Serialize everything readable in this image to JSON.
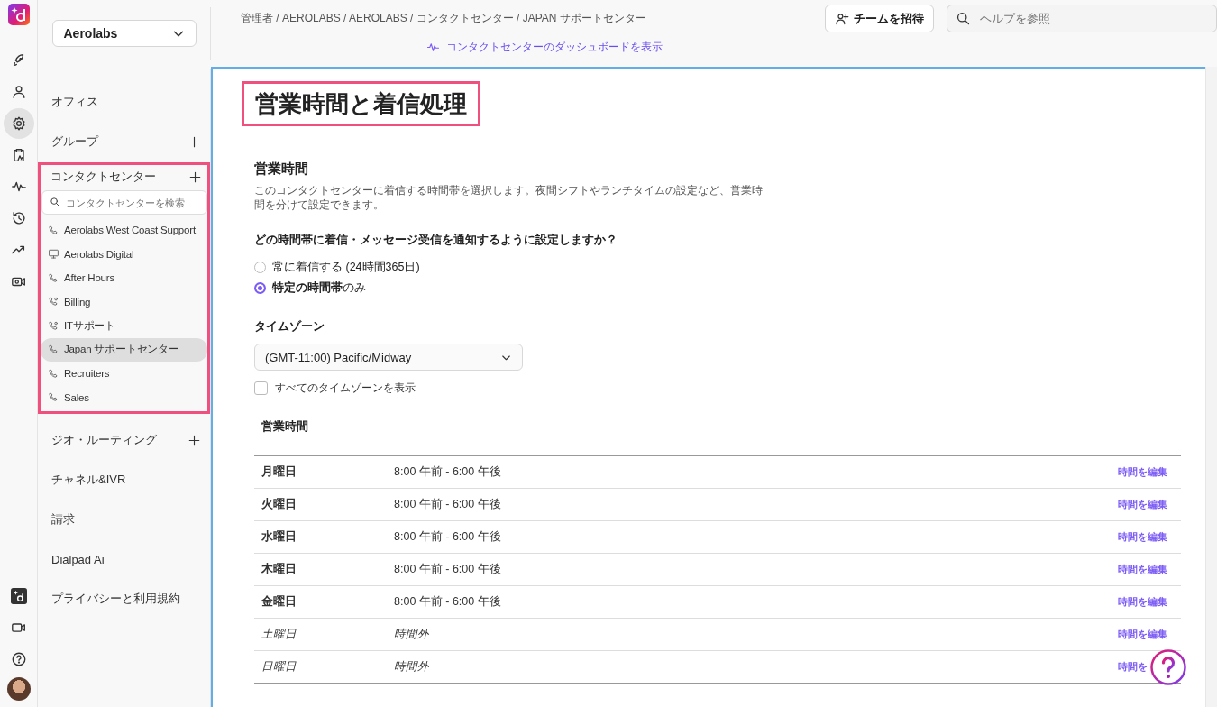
{
  "rail": {
    "top": [
      {
        "selected": false
      },
      {
        "selected": false
      },
      {
        "selected": true
      },
      {
        "selected": false
      },
      {
        "selected": false
      },
      {
        "selected": false
      },
      {
        "selected": false
      },
      {
        "selected": false
      }
    ]
  },
  "org_select": {
    "value": "Aerolabs"
  },
  "breadcrumb": "管理者 / AEROLABS / AEROLABS / コンタクトセンター / JAPAN サポートセンター",
  "dashboard_link": "コンタクトセンターのダッシュボードを表示",
  "invite_button": "チームを招待",
  "help_search": {
    "placeholder": "ヘルプを参照"
  },
  "sidebar": {
    "sections": [
      {
        "label": "オフィス",
        "addable": false
      },
      {
        "label": "グループ",
        "addable": true
      },
      {
        "label": "コンタクトセンター",
        "addable": true,
        "highlighted": true,
        "search": {
          "placeholder": "コンタクトセンターを検索"
        },
        "items": [
          {
            "label": "Aerolabs West Coast Support",
            "kind": "phone",
            "selected": false
          },
          {
            "label": "Aerolabs Digital",
            "kind": "monitor",
            "selected": false
          },
          {
            "label": "After Hours",
            "kind": "phone",
            "selected": false
          },
          {
            "label": "Billing",
            "kind": "phone-gear",
            "selected": false
          },
          {
            "label": "ITサポート",
            "kind": "phone-gear",
            "selected": false
          },
          {
            "label": "Japan サポートセンター",
            "kind": "phone",
            "selected": true
          },
          {
            "label": "Recruiters",
            "kind": "phone",
            "selected": false
          },
          {
            "label": "Sales",
            "kind": "phone",
            "selected": false
          }
        ]
      },
      {
        "label": "ジオ・ルーティング",
        "addable": true
      },
      {
        "label": "チャネル&IVR",
        "addable": false
      },
      {
        "label": "請求",
        "addable": false
      },
      {
        "label": "Dialpad Ai",
        "addable": false
      },
      {
        "label": "プライバシーと利用規約",
        "addable": false
      }
    ]
  },
  "page": {
    "title": "営業時間と着信処理",
    "title_highlighted": true,
    "section_title": "営業時間",
    "description": "このコンタクトセンターに着信する時間帯を選択します。夜間シフトやランチタイムの設定など、営業時間を分けて設定できます。",
    "question": "どの時間帯に着信・メッセージ受信を通知するように設定しますか？",
    "options": [
      {
        "label": "常に着信する (24時間365日)",
        "selected": false
      },
      {
        "label": "**特定の時間帯**のみ",
        "selected": true
      }
    ],
    "timezone_label": "タイムゾーン",
    "timezone_select": {
      "value": "(GMT-11:00) Pacific/Midway"
    },
    "show_all_timezones": {
      "label": "すべてのタイムゾーンを表示",
      "checked": false
    },
    "hours_heading": "営業時間",
    "hours": [
      {
        "day": "月曜日",
        "time": "8:00 午前 - 6:00 午後",
        "edit": "時間を編集",
        "off": false
      },
      {
        "day": "火曜日",
        "time": "8:00 午前 - 6:00 午後",
        "edit": "時間を編集",
        "off": false
      },
      {
        "day": "水曜日",
        "time": "8:00 午前 - 6:00 午後",
        "edit": "時間を編集",
        "off": false
      },
      {
        "day": "木曜日",
        "time": "8:00 午前 - 6:00 午後",
        "edit": "時間を編集",
        "off": false
      },
      {
        "day": "金曜日",
        "time": "8:00 午前 - 6:00 午後",
        "edit": "時間を編集",
        "off": false
      },
      {
        "day": "土曜日",
        "time": "時間外",
        "edit": "時間を編集",
        "off": true
      },
      {
        "day": "日曜日",
        "time": "時間外",
        "edit": "時間を",
        "off": true
      }
    ]
  }
}
